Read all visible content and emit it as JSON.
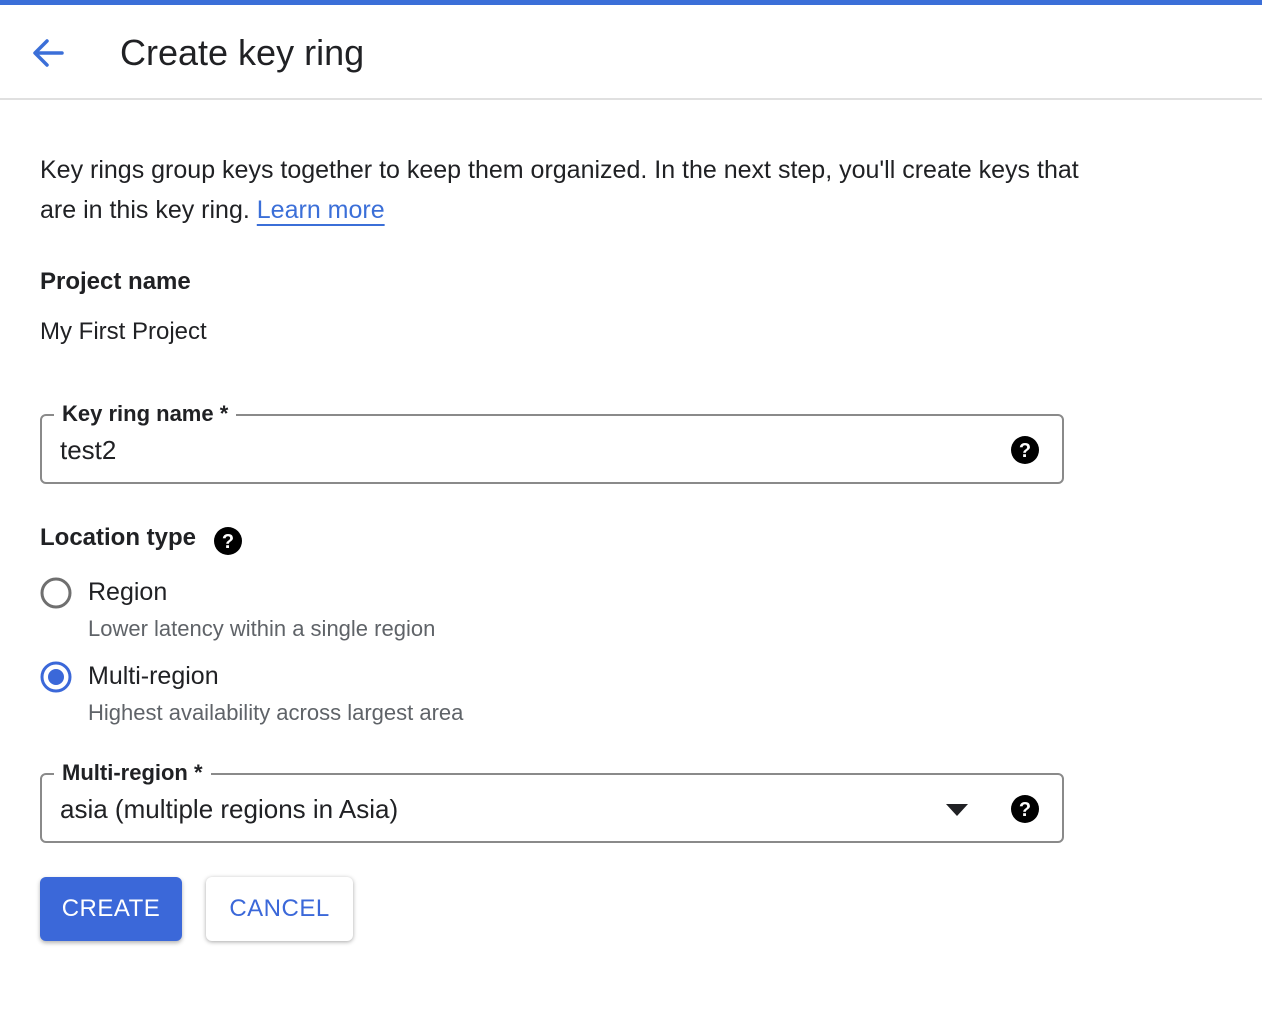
{
  "header": {
    "title": "Create key ring",
    "back_icon": "arrow-back-icon"
  },
  "description": {
    "text": "Key rings group keys together to keep them organized. In the next step, you'll create keys that are in this key ring.",
    "link_label": "Learn more"
  },
  "project": {
    "label": "Project name",
    "value": "My First Project"
  },
  "key_ring_name": {
    "label": "Key ring name *",
    "value": "test2",
    "help_icon": "help-icon"
  },
  "location_type": {
    "label": "Location type",
    "options": [
      {
        "label": "Region",
        "description": "Lower latency within a single region",
        "selected": false
      },
      {
        "label": "Multi-region",
        "description": "Highest availability across largest area",
        "selected": true
      }
    ]
  },
  "multi_region": {
    "label": "Multi-region *",
    "value": "asia (multiple regions in Asia)",
    "dropdown_icon": "dropdown-arrow-icon"
  },
  "actions": {
    "create_label": "CREATE",
    "cancel_label": "CANCEL"
  },
  "colors": {
    "accent": "#3b6fd8",
    "primary_button": "#3b68d9",
    "text": "#202124",
    "secondary_text": "#5f6368",
    "border": "#8a8a8a"
  }
}
